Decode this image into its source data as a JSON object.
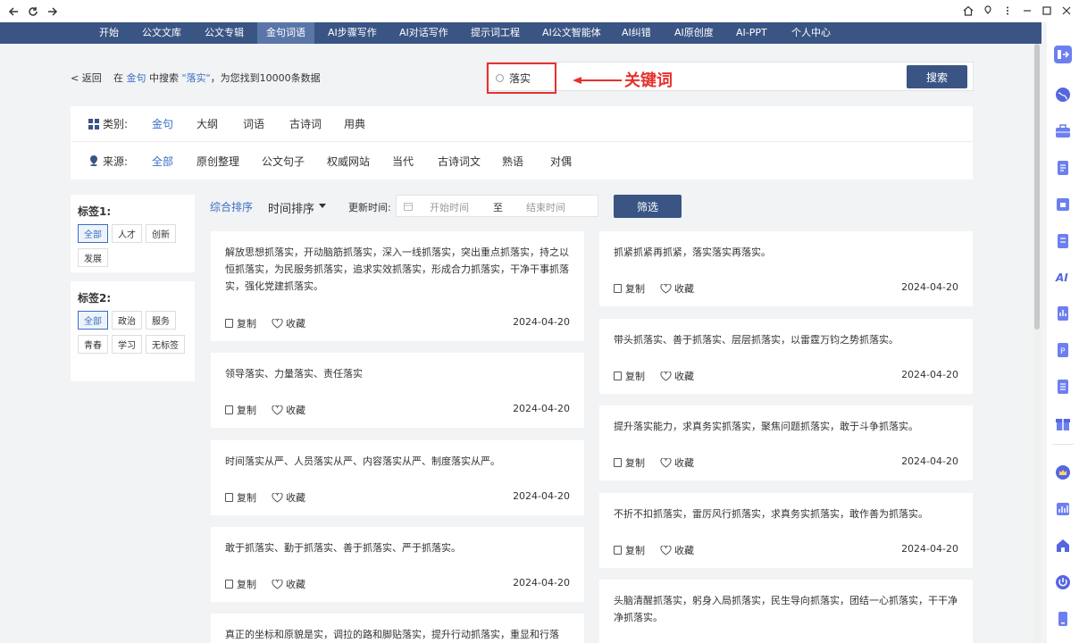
{
  "nav": {
    "items": [
      "开始",
      "公文文库",
      "公文专辑",
      "金句词语",
      "AI步骤写作",
      "AI对话写作",
      "提示词工程",
      "AI公文智能体",
      "AI纠错",
      "AI原创度",
      "AI-PPT",
      "个人中心"
    ],
    "active_index": 3
  },
  "header": {
    "back": "< 返回",
    "result_prefix": "在",
    "result_scope": "金句",
    "result_mid": "中搜索",
    "result_query": "\"落实\"",
    "result_suffix": "，为您找到10000条数据"
  },
  "search": {
    "value": "落实",
    "button": "搜索"
  },
  "annotation": {
    "text": "关键词",
    "color": "#e6312e"
  },
  "filters": {
    "category_label": "类别:",
    "categories": [
      "金句",
      "大纲",
      "词语",
      "古诗词",
      "用典"
    ],
    "category_selected": 0,
    "source_label": "来源:",
    "sources": [
      "全部",
      "原创整理",
      "公文句子",
      "权威网站",
      "当代",
      "古诗词文",
      "熟语",
      "对偶"
    ],
    "source_selected": 0
  },
  "tags1": {
    "title": "标签1:",
    "items": [
      "全部",
      "人才",
      "创新",
      "发展"
    ]
  },
  "tags2": {
    "title": "标签2:",
    "items": [
      "全部",
      "政治",
      "服务",
      "青春",
      "学习",
      "无标签"
    ]
  },
  "sort": {
    "composite": "综合排序",
    "time": "时间排序",
    "update_label": "更新时间:",
    "start_placeholder": "开始时间",
    "to": "至",
    "end_placeholder": "结束时间",
    "filter_button": "筛选"
  },
  "card_actions": {
    "copy": "复制",
    "fav": "收藏"
  },
  "cards_left": [
    {
      "text": "解放思想抓落实，开动脑筋抓落实，深入一线抓落实，突出重点抓落实，持之以恒抓落实，为民服务抓落实，追求实效抓落实，形成合力抓落实，干净干事抓落实，强化党建抓落实。",
      "date": "2024-04-20"
    },
    {
      "text": "领导落实、力量落实、责任落实",
      "date": "2024-04-20"
    },
    {
      "text": "时间落实从严、人员落实从严、内容落实从严、制度落实从严。",
      "date": "2024-04-20"
    },
    {
      "text": "敢于抓落实、勤于抓落实、善于抓落实、严于抓落实。",
      "date": "2024-04-20"
    },
    {
      "text": "真正的坐标和原貌是实，调拉的路和脚贴落实，提升行动抓落实，重显和行落",
      "date": ""
    }
  ],
  "cards_right": [
    {
      "text": "抓紧抓紧再抓紧，落实落实再落实。",
      "date": "2024-04-20"
    },
    {
      "text": "带头抓落实、善于抓落实、层层抓落实，以雷霆万钧之势抓落实。",
      "date": "2024-04-20"
    },
    {
      "text": "提升落实能力，求真务实抓落实，聚焦问题抓落实，敢于斗争抓落实。",
      "date": "2024-04-20"
    },
    {
      "text": "不折不扣抓落实，雷厉风行抓落实，求真务实抓落实，敢作善为抓落实。",
      "date": "2024-04-20"
    },
    {
      "text": "头脑清醒抓落实，躬身入局抓落实，民生导向抓落实，团结一心抓落实，干干净净抓落实。",
      "date": ""
    }
  ]
}
